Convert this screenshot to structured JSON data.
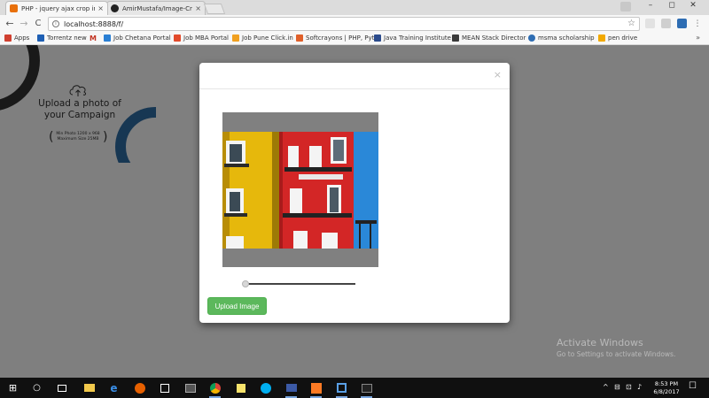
{
  "browser": {
    "tabs": [
      {
        "title": "PHP - jquery ajax crop im",
        "active": true,
        "favicon_color": "#e8700b"
      },
      {
        "title": "AmirMustafa/Image-Cro",
        "active": false,
        "favicon_color": "#222222"
      }
    ],
    "tab_close_glyph": "×",
    "window_controls": {
      "minimize": "–",
      "maximize": "◻",
      "close": "✕"
    },
    "address": "localhost:8888/f/",
    "nav": {
      "back": "←",
      "forward": "→",
      "reload": "C"
    },
    "bookmarks": [
      {
        "label": "Apps",
        "icon_color": "#d04030"
      },
      {
        "label": "Torrentz new",
        "icon_color": "#1e5fb4"
      },
      {
        "label": "",
        "icon_color": "#c23321",
        "glyph": "M"
      },
      {
        "label": "Job Chetana Portal",
        "icon_color": "#2a7fd4"
      },
      {
        "label": "Job MBA Portal",
        "icon_color": "#e24a2b"
      },
      {
        "label": "Job Pune Click.in",
        "icon_color": "#f0a020"
      },
      {
        "label": "Softcrayons | PHP, Pyt",
        "icon_color": "#e0602a"
      },
      {
        "label": "Java Training Institute",
        "icon_color": "#2b4b8c"
      },
      {
        "label": "MEAN Stack Director",
        "icon_color": "#3a3a3a"
      },
      {
        "label": "msma scholarship",
        "icon_color": "#2e6db3"
      },
      {
        "label": "pen drive",
        "icon_color": "#f2a900"
      }
    ],
    "bookmarks_more": "»"
  },
  "page": {
    "promo_title": "Upload a photo of your Campaign",
    "promo_subtitle": "Min Photo 1200 x 968 Maximum Size 25MB",
    "paren_open": "(",
    "paren_close": ")"
  },
  "modal": {
    "close_glyph": "×",
    "upload_button": "Upload Image",
    "zoom_level": 0.0
  },
  "watermark": {
    "title": "Activate Windows",
    "subtitle": "Go to Settings to activate Windows."
  },
  "taskbar": {
    "time": "8:53 PM",
    "date": "6/8/2017",
    "start_glyph": "⊞",
    "search_glyph": "○",
    "tray_glyphs": [
      "^",
      "⊟",
      "⊡",
      "♪"
    ],
    "notification_glyph": "☐"
  },
  "colors": {
    "accent_green": "#5cb85c",
    "backdrop": "rgba(0,0,0,0.5)",
    "crop_bg": "#808080"
  }
}
